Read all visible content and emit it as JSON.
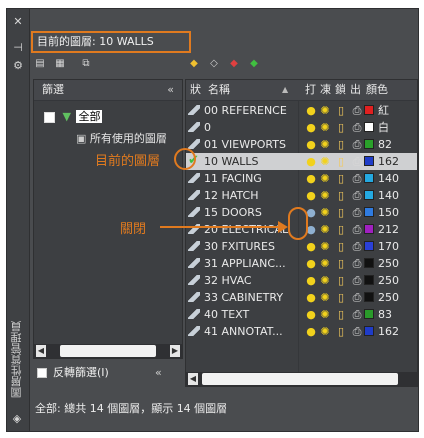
{
  "titlebar": {
    "vertical_title": "圖層性質管理員",
    "close_icon": "close-icon",
    "pin_icon": "autohide-icon",
    "settings_icon": "gear-icon"
  },
  "current_layer": {
    "text": "目前的圖層: 10 WALLS"
  },
  "filters": {
    "header": "篩選",
    "collapse": "«",
    "root": "全部",
    "child": "所有使用的圖層",
    "invert_label": "反轉篩選(I)",
    "invert_collapse": "«"
  },
  "grid": {
    "headers": {
      "status": "狀",
      "name": "名稱",
      "on": "打",
      "freeze": "凍",
      "lock": "鎖",
      "plot": "出",
      "color": "顏色"
    },
    "rows": [
      {
        "name": "00 REFERENCE",
        "color": "#e02020",
        "color_name": "紅",
        "on": true,
        "selected": false
      },
      {
        "name": "0",
        "color": "#ffffff",
        "color_name": "白",
        "on": true,
        "selected": false
      },
      {
        "name": "01 VIEWPORTS",
        "color": "#2aa02a",
        "color_name": "82",
        "on": true,
        "selected": false
      },
      {
        "name": "10 WALLS",
        "color": "#1f3cc8",
        "color_name": "162",
        "on": true,
        "selected": true
      },
      {
        "name": "11 FACING",
        "color": "#24a8e0",
        "color_name": "140",
        "on": true,
        "selected": false
      },
      {
        "name": "12 HATCH",
        "color": "#24a8e0",
        "color_name": "140",
        "on": true,
        "selected": false
      },
      {
        "name": "15 DOORS",
        "color": "#2f7be0",
        "color_name": "150",
        "on": false,
        "selected": false
      },
      {
        "name": "20 ELECTRICAL",
        "color": "#a020c0",
        "color_name": "212",
        "on": false,
        "selected": false
      },
      {
        "name": "30 FXITURES",
        "color": "#2a40d8",
        "color_name": "170",
        "on": true,
        "selected": false
      },
      {
        "name": "31  APPLIANC...",
        "color": "#111111",
        "color_name": "250",
        "on": true,
        "selected": false
      },
      {
        "name": "32 HVAC",
        "color": "#111111",
        "color_name": "250",
        "on": true,
        "selected": false
      },
      {
        "name": "33 CABINETRY",
        "color": "#111111",
        "color_name": "250",
        "on": true,
        "selected": false
      },
      {
        "name": "40 TEXT",
        "color": "#2a9a2a",
        "color_name": "83",
        "on": true,
        "selected": false
      },
      {
        "name": "41 ANNOTAT...",
        "color": "#1f3cc8",
        "color_name": "162",
        "on": true,
        "selected": false
      }
    ]
  },
  "annotations": {
    "current_layer_label": "目前的圖層",
    "off_label": "關閉"
  },
  "footer": {
    "text": "全部: 總共 14 個圖層，顯示 14 個圖層"
  },
  "colors": {
    "accent": "#e07a1f",
    "panel_bg": "#4a4c4f"
  }
}
